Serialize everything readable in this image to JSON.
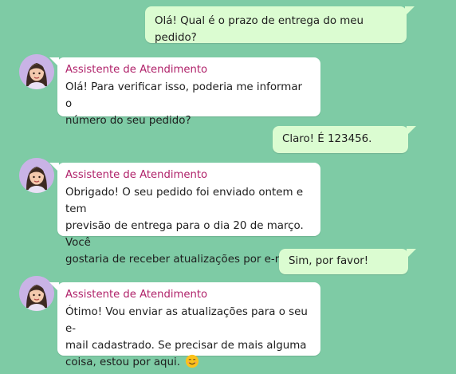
{
  "theme": {
    "background": "#7ecba5",
    "user_bubble": "#dbfcd1",
    "agent_bubble": "#ffffff",
    "agent_name_color": "#b0226a"
  },
  "messages": [
    {
      "role": "user",
      "text": "Olá! Qual é o prazo de entrega do meu pedido?"
    },
    {
      "role": "agent",
      "name": "Assistente de Atendimento",
      "lines": [
        "Olá! Para verificar isso, poderia me informar o",
        "número do seu pedido?"
      ]
    },
    {
      "role": "user",
      "text": "Claro! É 123456."
    },
    {
      "role": "agent",
      "name": "Assistente de Atendimento",
      "lines": [
        "Obrigado! O seu pedido foi enviado ontem e tem",
        "previsão de entrega para o dia 20 de março. Você",
        "gostaria de receber atualizações por e-mail?"
      ]
    },
    {
      "role": "user",
      "text": "Sim, por favor!"
    },
    {
      "role": "agent",
      "name": "Assistente de Atendimento",
      "lines": [
        "Ótimo! Vou enviar as atualizações para o seu e-",
        "mail cadastrado. Se precisar de mais alguma",
        "coisa, estou por aqui."
      ],
      "emoji": "smiling-face-emoji"
    }
  ]
}
